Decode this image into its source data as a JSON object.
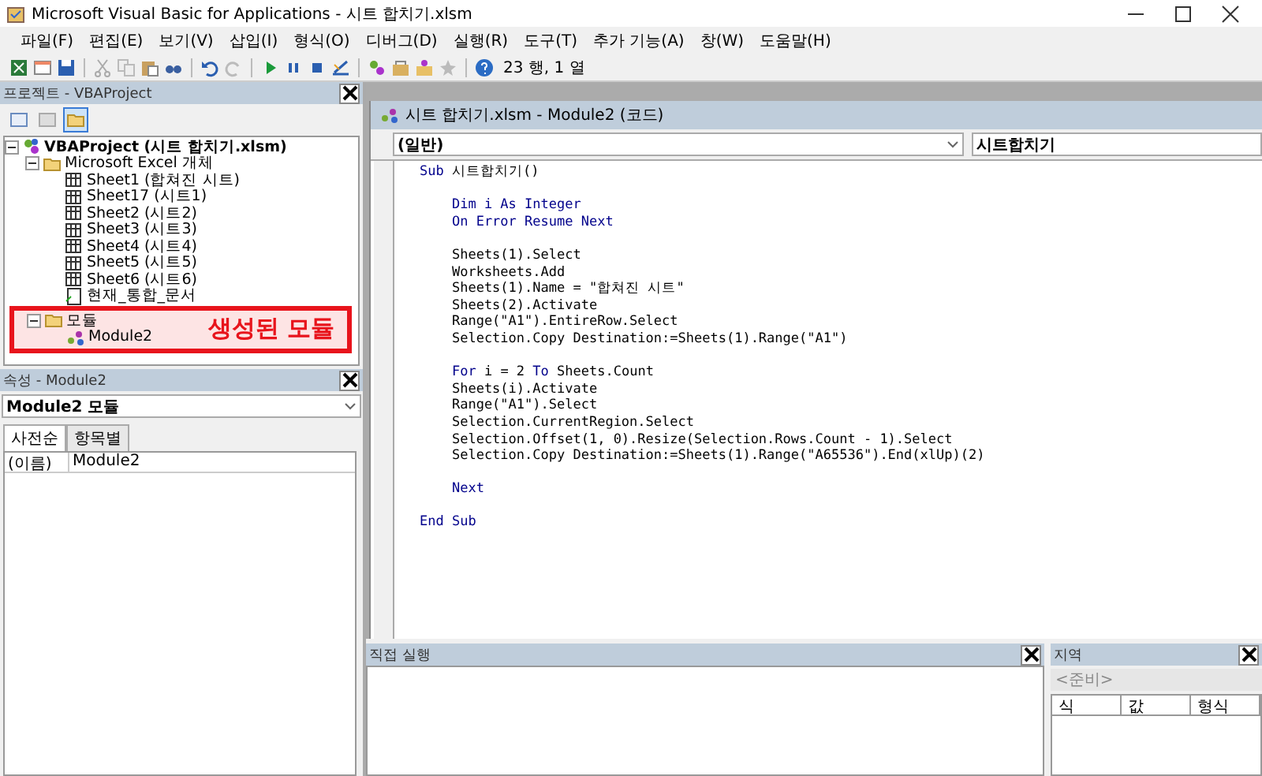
{
  "window": {
    "title": "Microsoft Visual Basic for Applications - 시트 합치기.xlsm"
  },
  "menu": [
    "파일(F)",
    "편집(E)",
    "보기(V)",
    "삽입(I)",
    "형식(O)",
    "디버그(D)",
    "실행(R)",
    "도구(T)",
    "추가 기능(A)",
    "창(W)",
    "도움말(H)"
  ],
  "toolbar": {
    "position": "23 행, 1 열"
  },
  "project_explorer": {
    "title": "프로젝트 - VBAProject",
    "tree": [
      {
        "label": "VBAProject (시트 합치기.xlsm)",
        "kind": "project",
        "expanded": true,
        "children": [
          {
            "label": "Microsoft Excel 개체",
            "kind": "folder",
            "expanded": true,
            "children": [
              {
                "label": "Sheet1 (합쳐진 시트)",
                "kind": "sheet"
              },
              {
                "label": "Sheet17 (시트1)",
                "kind": "sheet"
              },
              {
                "label": "Sheet2 (시트2)",
                "kind": "sheet"
              },
              {
                "label": "Sheet3 (시트3)",
                "kind": "sheet"
              },
              {
                "label": "Sheet4 (시트4)",
                "kind": "sheet"
              },
              {
                "label": "Sheet5 (시트5)",
                "kind": "sheet"
              },
              {
                "label": "Sheet6 (시트6)",
                "kind": "sheet"
              },
              {
                "label": "현재_통합_문서",
                "kind": "workbook"
              }
            ]
          },
          {
            "label": "모듈",
            "kind": "folder",
            "expanded": true,
            "callout": "생성된 모듈",
            "children": [
              {
                "label": "Module2",
                "kind": "module"
              }
            ]
          }
        ]
      }
    ]
  },
  "properties": {
    "title": "속성 - Module2",
    "object": "Module2 모듈",
    "tabs": [
      {
        "label": "사전순",
        "selected": true
      },
      {
        "label": "항목별",
        "selected": false
      }
    ],
    "rows": [
      {
        "name": "(이름)",
        "value": "Module2"
      }
    ]
  },
  "code_window": {
    "title": "시트 합치기.xlsm - Module2 (코드)",
    "object": "(일반)",
    "procedure": "시트합치기",
    "lines": [
      [
        {
          "kind": "keyword",
          "text": "Sub "
        },
        {
          "kind": "plain",
          "text": "시트합치기()"
        }
      ],
      [
        {
          "kind": "blank"
        }
      ],
      [
        {
          "kind": "keyword",
          "text": "    Dim i As Integer"
        }
      ],
      [
        {
          "kind": "keyword",
          "text": "    On Error Resume Next"
        }
      ],
      [
        {
          "kind": "blank"
        }
      ],
      [
        {
          "kind": "plain",
          "text": "    Sheets(1).Select"
        }
      ],
      [
        {
          "kind": "plain",
          "text": "    Worksheets.Add"
        }
      ],
      [
        {
          "kind": "plain",
          "text": "    Sheets(1).Name = \"합쳐진 시트\""
        }
      ],
      [
        {
          "kind": "plain",
          "text": "    Sheets(2).Activate"
        }
      ],
      [
        {
          "kind": "plain",
          "text": "    Range(\"A1\").EntireRow.Select"
        }
      ],
      [
        {
          "kind": "plain",
          "text": "    Selection.Copy Destination:=Sheets(1).Range(\"A1\")"
        }
      ],
      [
        {
          "kind": "blank"
        }
      ],
      [
        {
          "kind": "keyword",
          "text": "    For "
        },
        {
          "kind": "plain",
          "text": "i = 2 "
        },
        {
          "kind": "keyword",
          "text": "To "
        },
        {
          "kind": "plain",
          "text": "Sheets.Count"
        }
      ],
      [
        {
          "kind": "plain",
          "text": "    Sheets(i).Activate"
        }
      ],
      [
        {
          "kind": "plain",
          "text": "    Range(\"A1\").Select"
        }
      ],
      [
        {
          "kind": "plain",
          "text": "    Selection.CurrentRegion.Select"
        }
      ],
      [
        {
          "kind": "plain",
          "text": "    Selection.Offset(1, 0).Resize(Selection.Rows.Count - 1).Select"
        }
      ],
      [
        {
          "kind": "plain",
          "text": "    Selection.Copy Destination:=Sheets(1).Range(\"A65536\").End(xlUp)(2)"
        }
      ],
      [
        {
          "kind": "blank"
        }
      ],
      [
        {
          "kind": "keyword",
          "text": "    Next"
        }
      ],
      [
        {
          "kind": "blank"
        }
      ],
      [
        {
          "kind": "keyword",
          "text": "End Sub"
        }
      ]
    ]
  },
  "immediate": {
    "title": "직접 실행"
  },
  "locals": {
    "title": "지역",
    "status": "<준비>",
    "columns": [
      "식",
      "값",
      "형식"
    ]
  }
}
